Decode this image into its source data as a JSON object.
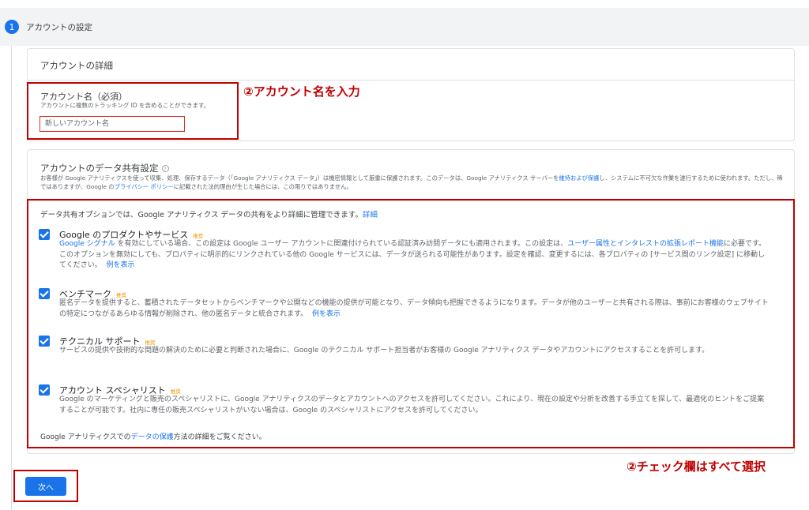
{
  "step": {
    "number": "1",
    "title": "アカウントの設定"
  },
  "account_details": {
    "header": "アカウントの詳細",
    "name_label": "アカウント名（必須）",
    "name_help": "アカウントに複数のトラッキング ID を含めることができます。",
    "name_placeholder": "新しいアカウント名"
  },
  "data_sharing": {
    "title": "アカウントのデータ共有設定",
    "description_part1": "お客様が Google アナリティクスを使って収集、処理、保存するデータ（「Google アナリティクス データ」）は機密情報として厳重に保護されます。このデータは、Google アナリティクス サーバーを",
    "description_link1": "維持および保護",
    "description_part2": "し、システムに不可欠な作業を遂行するために使われます。ただし、稀ではありますが、Google の",
    "description_link2": "プライバシー ポリシー",
    "description_part3": "に記載された法的理由が生じた場合には、この限りではありません。",
    "intro_text": "データ共有オプションでは、Google アナリティクス データの共有をより詳細に管理できます。",
    "intro_link": "詳細",
    "recommended_label": "推奨",
    "options": [
      {
        "title": "Google のプロダクトやサービス",
        "checked": true,
        "link_a": "Google シグナル",
        "desc_a": " を有効にしている場合、この設定は Google ユーザー アカウントに関連付けられている認証済み訪問データにも適用されます。この設定は、",
        "link_b": "ユーザー属性とインタレストの拡張レポート機能",
        "desc_b": "に必要です。このオプションを無効にしても、プロパティに明示的にリンクされている他の Google サービスには、データが送られる可能性があります。設定を確認、変更するには、各プロパティの [サービス間のリンク設定] に移動してください。",
        "link_example": "例を表示"
      },
      {
        "title": "ベンチマーク",
        "checked": true,
        "desc": "匿名データを提供すると、蓄積されたデータセットからベンチマークや公開などの機能の提供が可能となり、データ傾向も把握できるようになります。データが他のユーザーと共有される際は、事前にお客様のウェブサイトの特定につながるあらゆる情報が削除され、他の匿名データと統合されます。",
        "link_example": "例を表示"
      },
      {
        "title": "テクニカル サポート",
        "checked": true,
        "desc": "サービスの提供や技術的な問題の解決のために必要と判断された場合に、Google のテクニカル サポート担当者がお客様の Google アナリティクス データやアカウントにアクセスすることを許可します。"
      },
      {
        "title": "アカウント スペシャリスト",
        "checked": true,
        "desc": "Google のマーケティングと販売のスペシャリストに、Google アナリティクスのデータとアカウントへのアクセスを許可してください。これにより、現在の設定や分析を改善する手立てを探して、最適化のヒントをご提案することが可能です。社内に専任の販売スペシャリストがいない場合は、Google のスペシャリストにアクセスを許可してください。"
      }
    ],
    "footer_part1": "Google アナリティクスでの",
    "footer_link": "データの保護",
    "footer_part2": "方法の詳細をご覧ください。"
  },
  "next_button": "次へ",
  "annotations": {
    "account_name": "②アカウント名を入力",
    "checkboxes": "②チェック欄はすべて選択",
    "color": "#c00000"
  },
  "colors": {
    "accent": "#1a73e8",
    "recommended": "#f29900"
  }
}
